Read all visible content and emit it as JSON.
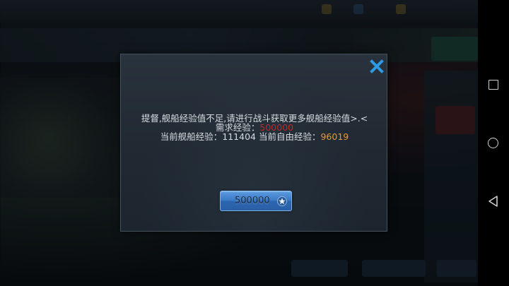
{
  "dialog": {
    "line1": "提督,舰船经验值不足,请进行战斗获取更多舰船经验值>.<",
    "required_label": "需求经验：",
    "required_value": "500000",
    "current_ship_label": "当前舰船经验：",
    "current_ship_value": "111404",
    "current_free_label": "当前自由经验：",
    "current_free_value": "96019",
    "cost_button_value": "500000"
  },
  "icons": {
    "close": "close-icon",
    "currency": "star-icon",
    "nav_recent": "square-icon",
    "nav_home": "circle-icon",
    "nav_back": "triangle-back-icon"
  },
  "colors": {
    "required_value": "#c0282a",
    "free_value": "#e89a2c",
    "close_icon": "#2e9be6",
    "button_blue": "#3a79c4"
  }
}
